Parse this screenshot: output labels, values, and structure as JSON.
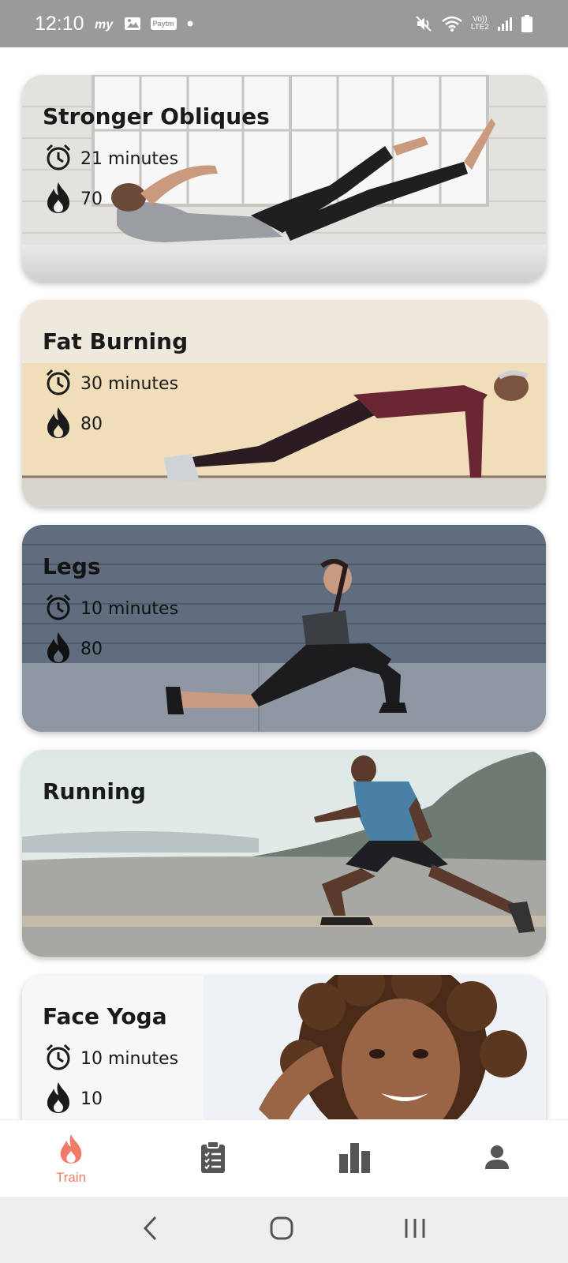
{
  "status_bar": {
    "time": "12:10",
    "left_icons": [
      "myjio-icon",
      "gallery-icon",
      "paytm-icon",
      "dot-icon"
    ],
    "paytm_label": "Paytm",
    "network_label_top": "Vo))",
    "network_label_bottom": "LTE2",
    "right_icons": [
      "mute-icon",
      "wifi-icon",
      "signal-icon",
      "battery-icon"
    ]
  },
  "workouts": [
    {
      "title": "Stronger Obliques",
      "duration": "21 minutes",
      "calories": "70"
    },
    {
      "title": "Fat Burning",
      "duration": "30 minutes",
      "calories": "80"
    },
    {
      "title": "Legs",
      "duration": "10 minutes",
      "calories": "80"
    },
    {
      "title": "Running"
    },
    {
      "title": "Face Yoga",
      "duration": "10 minutes",
      "calories": "10"
    }
  ],
  "bottom_nav": {
    "items": [
      {
        "icon": "flame-icon",
        "label": "Train",
        "active": true
      },
      {
        "icon": "clipboard-icon",
        "label": ""
      },
      {
        "icon": "bar-chart-icon",
        "label": ""
      },
      {
        "icon": "person-icon",
        "label": ""
      }
    ],
    "active_color": "#f07b6b",
    "inactive_color": "#555555"
  },
  "system_nav": {
    "icons": [
      "back-icon",
      "home-icon",
      "recents-icon"
    ]
  }
}
